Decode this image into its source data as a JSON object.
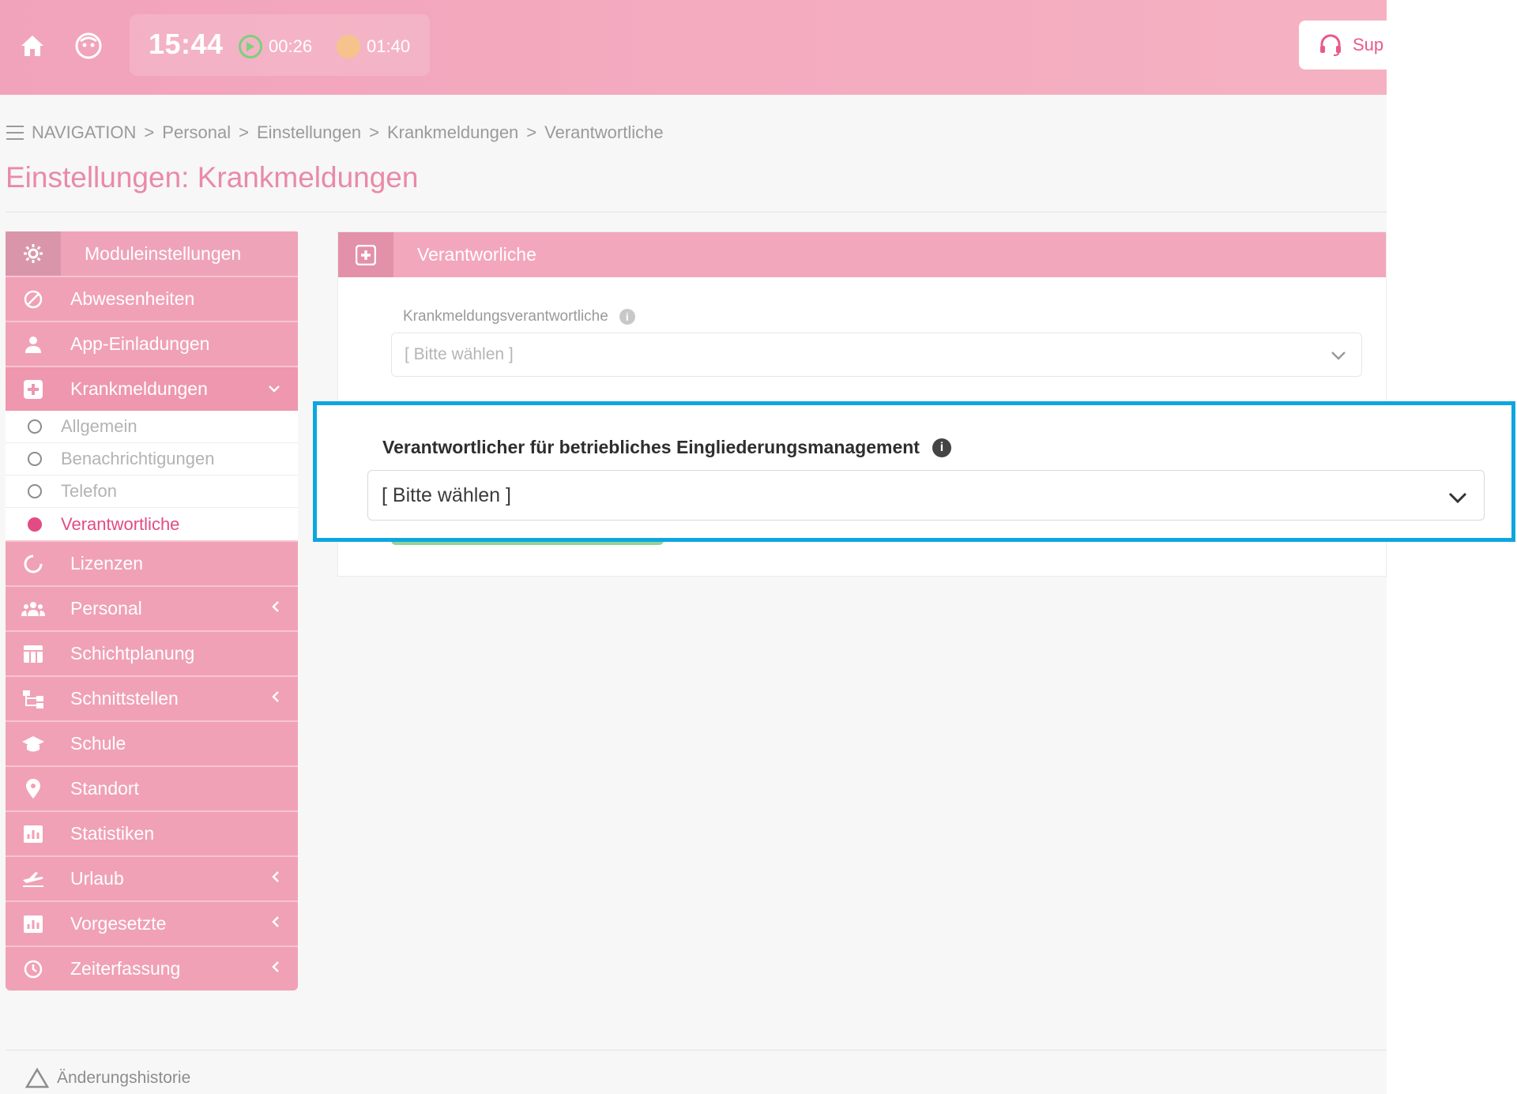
{
  "topbar": {
    "time": "15:44",
    "work_timer": "00:26",
    "break_timer": "01:40",
    "support_label": "Sup",
    "colors": {
      "bar": "#f5b1c2",
      "accent": "#e24b83",
      "work_timer": "#7bd07b",
      "break_timer": "#f6c38c"
    }
  },
  "breadcrumb": {
    "root": "NAVIGATION",
    "items": [
      "Personal",
      "Einstellungen",
      "Krankmeldungen",
      "Verantwortliche"
    ],
    "separator": ">"
  },
  "page": {
    "title": "Einstellungen: Krankmeldungen"
  },
  "sidebar": {
    "header": "Moduleinstellungen",
    "items": [
      {
        "label": "Abwesenheiten",
        "icon": "ban-icon",
        "has_children": false
      },
      {
        "label": "App-Einladungen",
        "icon": "user-icon",
        "has_children": false
      },
      {
        "label": "Krankmeldungen",
        "icon": "medical-plus-icon",
        "has_children": true,
        "expanded": true
      },
      {
        "label": "Lizenzen",
        "icon": "circle-notch-icon",
        "has_children": false
      },
      {
        "label": "Personal",
        "icon": "users-icon",
        "has_children": true
      },
      {
        "label": "Schichtplanung",
        "icon": "table-icon",
        "has_children": false
      },
      {
        "label": "Schnittstellen",
        "icon": "sitemap-icon",
        "has_children": true
      },
      {
        "label": "Schule",
        "icon": "graduation-cap-icon",
        "has_children": false
      },
      {
        "label": "Standort",
        "icon": "map-marker-icon",
        "has_children": false
      },
      {
        "label": "Statistiken",
        "icon": "chart-icon",
        "has_children": false
      },
      {
        "label": "Urlaub",
        "icon": "plane-icon",
        "has_children": true
      },
      {
        "label": "Vorgesetzte",
        "icon": "chart-box-icon",
        "has_children": true
      },
      {
        "label": "Zeiterfassung",
        "icon": "clock-icon",
        "has_children": true
      }
    ],
    "subitems": [
      {
        "label": "Allgemein",
        "current": false
      },
      {
        "label": "Benachrichtigungen",
        "current": false
      },
      {
        "label": "Telefon",
        "current": false
      },
      {
        "label": "Verantwortliche",
        "current": true
      }
    ]
  },
  "panel": {
    "header": "Verantworliche",
    "field1": {
      "label": "Krankmeldungsverantwortliche",
      "value": "[ Bitte wählen ]"
    },
    "field2": {
      "label": "Verantwortlicher für betriebliches Eingliederungsmanagement",
      "value": "[ Bitte wählen ]"
    }
  },
  "footer": {
    "history_label": "Änderungshistorie"
  },
  "highlight_color": "#0fa6e0"
}
